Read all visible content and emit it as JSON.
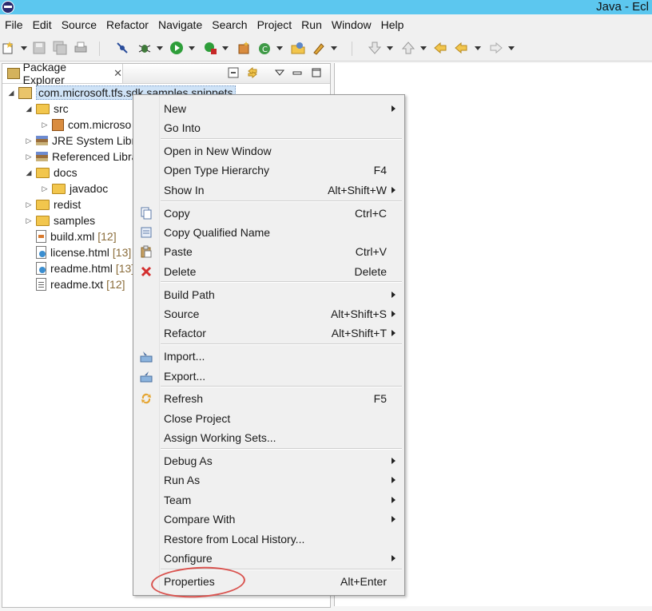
{
  "titlebar": {
    "title": "Java - Ecl"
  },
  "menubar": [
    "File",
    "Edit",
    "Source",
    "Refactor",
    "Navigate",
    "Search",
    "Project",
    "Run",
    "Window",
    "Help"
  ],
  "view": {
    "tab_label": "Package Explorer"
  },
  "tree": [
    {
      "label": "com.microsoft.tfs.sdk.samples.snippets",
      "decoration": "",
      "icon": "project-icon",
      "twisty": "expanded",
      "selected": true
    },
    {
      "label": "src",
      "decoration": "",
      "icon": "source-folder-icon",
      "twisty": "expanded"
    },
    {
      "label": "com.microso",
      "decoration": "",
      "icon": "package-icon",
      "twisty": "collapsed"
    },
    {
      "label": "JRE System Librar",
      "decoration": "",
      "icon": "library-icon",
      "twisty": "collapsed"
    },
    {
      "label": "Referenced Libra",
      "decoration": "",
      "icon": "library-icon",
      "twisty": "collapsed"
    },
    {
      "label": "docs",
      "decoration": "",
      "icon": "folder-icon",
      "twisty": "expanded"
    },
    {
      "label": "javadoc",
      "decoration": "",
      "icon": "folder-icon",
      "twisty": "collapsed"
    },
    {
      "label": "redist",
      "decoration": "",
      "icon": "folder-icon",
      "twisty": "collapsed"
    },
    {
      "label": "samples",
      "decoration": "",
      "icon": "folder-icon",
      "twisty": "collapsed"
    },
    {
      "label": "build.xml",
      "decoration": "[12]",
      "icon": "xml-file-icon",
      "twisty": "none"
    },
    {
      "label": "license.html",
      "decoration": "[13]",
      "icon": "html-file-icon",
      "twisty": "none"
    },
    {
      "label": "readme.html",
      "decoration": "[13]",
      "icon": "html-file-icon",
      "twisty": "none"
    },
    {
      "label": "readme.txt",
      "decoration": "[12]",
      "icon": "text-file-icon",
      "twisty": "none"
    }
  ],
  "context_menu": {
    "items": [
      {
        "label": "New",
        "accel": "",
        "submenu": true,
        "icon": ""
      },
      {
        "label": "Go Into",
        "accel": "",
        "submenu": false,
        "icon": ""
      },
      {
        "label": "Open in New Window",
        "accel": "",
        "submenu": false,
        "icon": ""
      },
      {
        "label": "Open Type Hierarchy",
        "accel": "F4",
        "submenu": false,
        "icon": ""
      },
      {
        "label": "Show In",
        "accel": "Alt+Shift+W",
        "submenu": true,
        "icon": ""
      },
      {
        "label": "Copy",
        "accel": "Ctrl+C",
        "submenu": false,
        "icon": "copy-icon"
      },
      {
        "label": "Copy Qualified Name",
        "accel": "",
        "submenu": false,
        "icon": "copy-qualified-icon"
      },
      {
        "label": "Paste",
        "accel": "Ctrl+V",
        "submenu": false,
        "icon": "paste-icon"
      },
      {
        "label": "Delete",
        "accel": "Delete",
        "submenu": false,
        "icon": "delete-icon"
      },
      {
        "label": "Build Path",
        "accel": "",
        "submenu": true,
        "icon": ""
      },
      {
        "label": "Source",
        "accel": "Alt+Shift+S",
        "submenu": true,
        "icon": ""
      },
      {
        "label": "Refactor",
        "accel": "Alt+Shift+T",
        "submenu": true,
        "icon": ""
      },
      {
        "label": "Import...",
        "accel": "",
        "submenu": false,
        "icon": "import-icon"
      },
      {
        "label": "Export...",
        "accel": "",
        "submenu": false,
        "icon": "export-icon"
      },
      {
        "label": "Refresh",
        "accel": "F5",
        "submenu": false,
        "icon": "refresh-icon"
      },
      {
        "label": "Close Project",
        "accel": "",
        "submenu": false,
        "icon": ""
      },
      {
        "label": "Assign Working Sets...",
        "accel": "",
        "submenu": false,
        "icon": ""
      },
      {
        "label": "Debug As",
        "accel": "",
        "submenu": true,
        "icon": ""
      },
      {
        "label": "Run As",
        "accel": "",
        "submenu": true,
        "icon": ""
      },
      {
        "label": "Team",
        "accel": "",
        "submenu": true,
        "icon": ""
      },
      {
        "label": "Compare With",
        "accel": "",
        "submenu": true,
        "icon": ""
      },
      {
        "label": "Restore from Local History...",
        "accel": "",
        "submenu": false,
        "icon": ""
      },
      {
        "label": "Configure",
        "accel": "",
        "submenu": true,
        "icon": ""
      },
      {
        "label": "Properties",
        "accel": "Alt+Enter",
        "submenu": false,
        "icon": ""
      }
    ]
  },
  "colors": {
    "titlebar": "#5cc7ef",
    "highlight_ring": "#d9534f",
    "selection": "#cfe3f7"
  }
}
